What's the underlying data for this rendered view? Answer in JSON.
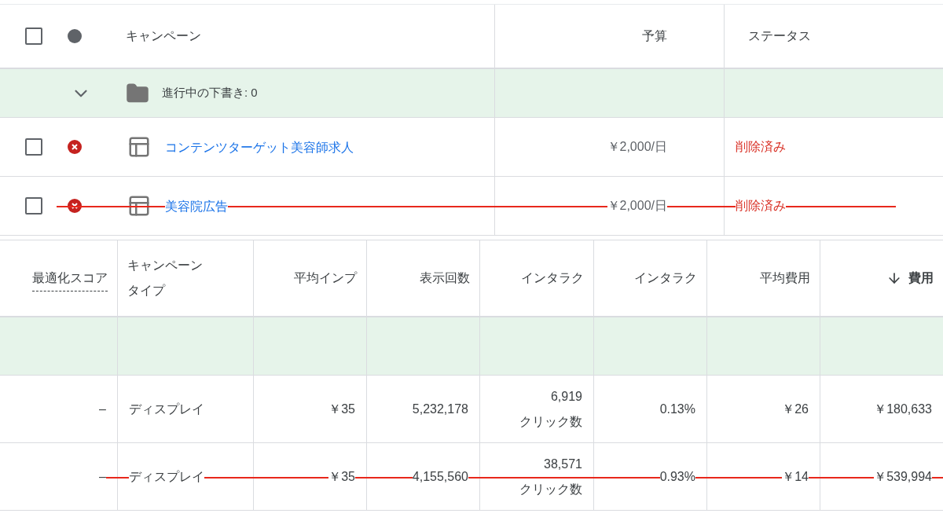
{
  "campaign_table": {
    "columns": [
      {
        "label": "キャンペーン"
      },
      {
        "label": "予算"
      },
      {
        "label": "ステータス"
      }
    ],
    "header_checkbox": {
      "checked": false
    },
    "group_row": {
      "expanded": true,
      "label": "進行中の下書き: 0"
    },
    "rows": [
      {
        "checked": false,
        "name": "コンテンツターゲット美容師求人",
        "budget": "￥2,000/日",
        "status": "削除済み",
        "struck": false
      },
      {
        "checked": false,
        "name": "美容院広告",
        "budget": "￥2,000/日",
        "status": "削除済み",
        "struck": true
      }
    ]
  },
  "stats_table": {
    "columns": [
      {
        "label": "最適化スコア",
        "sorted": false
      },
      {
        "label": "キャンペーンタイプ",
        "sorted": false
      },
      {
        "label": "平均インプ",
        "sorted": false
      },
      {
        "label": "表示回数",
        "sorted": false
      },
      {
        "label": "インタラク",
        "sorted": false
      },
      {
        "label": "インタラク",
        "sorted": false
      },
      {
        "label": "平均費用",
        "sorted": false
      },
      {
        "label": "費用",
        "sorted": true
      }
    ],
    "rows": [
      {
        "score": "–",
        "type": "ディスプレイ",
        "avg_imp": "￥35",
        "impressions": "5,232,178",
        "interactions": "6,919",
        "interactions_unit": "クリック数",
        "rate": "0.13%",
        "avg_cost": "￥26",
        "cost": "￥180,633",
        "struck": false
      },
      {
        "score": "–",
        "type": "ディスプレイ",
        "avg_imp": "￥35",
        "impressions": "4,155,560",
        "interactions": "38,571",
        "interactions_unit": "クリック数",
        "rate": "0.93%",
        "avg_cost": "￥14",
        "cost": "￥539,994",
        "struck": true
      }
    ]
  }
}
